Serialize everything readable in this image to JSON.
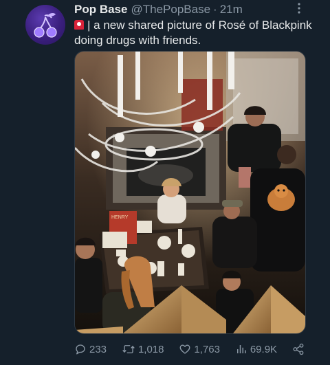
{
  "tweet": {
    "author_name": "Pop Base",
    "author_handle": "@ThePopBase",
    "separator": "·",
    "time": "21m",
    "text": "| a new shared picture of Rosé of Blackpink doing drugs with friends.",
    "media_label": "HENRY"
  },
  "actions": {
    "replies": "233",
    "retweets": "1,018",
    "likes": "1,763",
    "views": "69.9K"
  },
  "icons": {
    "more": "more-icon",
    "reply": "reply-icon",
    "retweet": "retweet-icon",
    "like": "heart-icon",
    "views": "views-icon",
    "share": "share-icon",
    "siren": "siren-emoji-icon"
  },
  "colors": {
    "background": "#15202b",
    "text": "#e7e9ea",
    "muted": "#8b98a5",
    "accent": "#1d9bf0"
  }
}
